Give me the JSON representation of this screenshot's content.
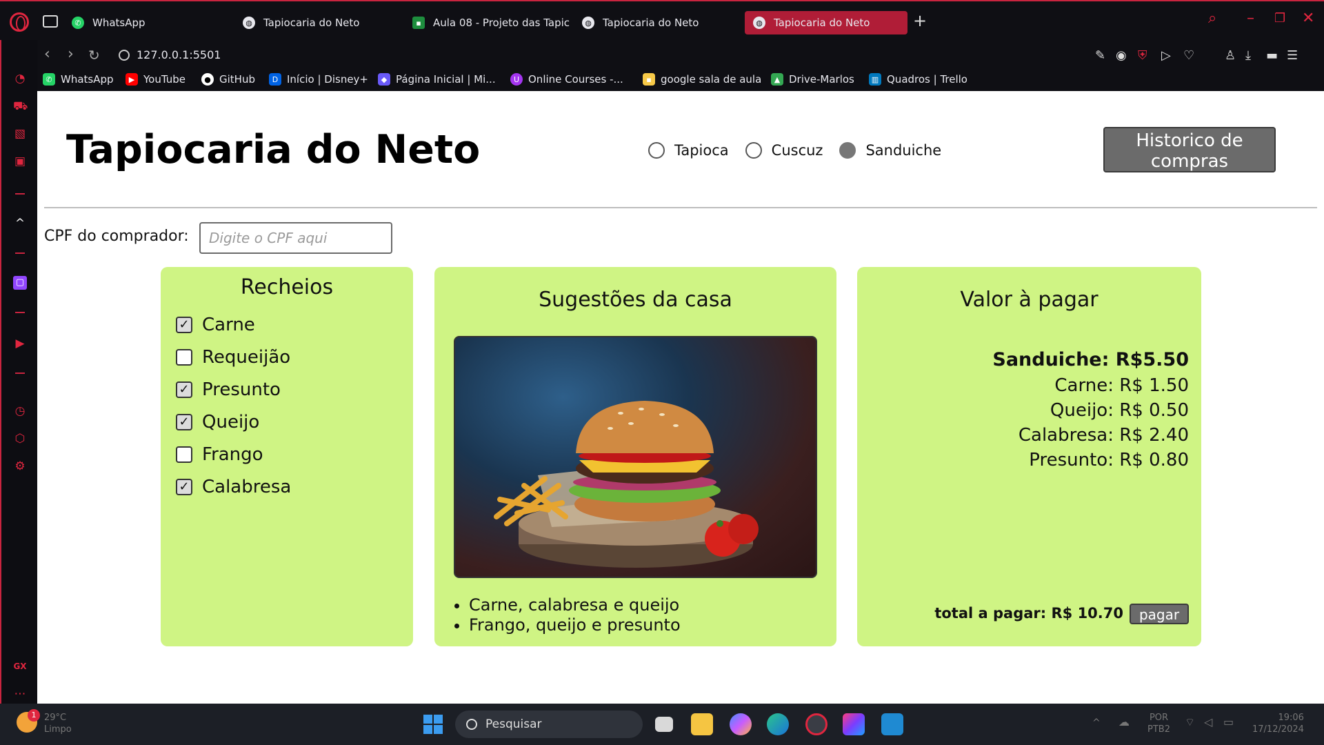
{
  "browser": {
    "tabs": [
      {
        "label": "WhatsApp",
        "icon": "whatsapp-icon",
        "active": false
      },
      {
        "label": "Tapiocaria do Neto",
        "icon": "globe-icon",
        "active": false
      },
      {
        "label": "Aula 08 - Projeto das Tapic",
        "icon": "classroom-icon",
        "active": false
      },
      {
        "label": "Tapiocaria do Neto",
        "icon": "globe-icon",
        "active": false
      },
      {
        "label": "Tapiocaria do Neto",
        "icon": "globe-icon",
        "active": true
      }
    ],
    "url": "127.0.0.1:5501",
    "bookmarks": [
      {
        "label": "WhatsApp",
        "icon": "whatsapp-icon",
        "color": "#25d366"
      },
      {
        "label": "YouTube",
        "icon": "youtube-icon",
        "color": "#ff0000"
      },
      {
        "label": "GitHub",
        "icon": "github-icon",
        "color": "#ffffff"
      },
      {
        "label": "Início | Disney+",
        "icon": "disney-icon",
        "color": "#0063e5"
      },
      {
        "label": "Página Inicial | Mi...",
        "icon": "microsoft-icon",
        "color": "#6a5af9"
      },
      {
        "label": "Online Courses -...",
        "icon": "udemy-icon",
        "color": "#a435f0"
      },
      {
        "label": "google sala de aula",
        "icon": "classroom-icon",
        "color": "#f7c948"
      },
      {
        "label": "Drive-Marlos",
        "icon": "drive-icon",
        "color": "#34a853"
      },
      {
        "label": "Quadros | Trello",
        "icon": "trello-icon",
        "color": "#0079bf"
      }
    ],
    "accent_color": "#c9243f"
  },
  "page": {
    "title": "Tapiocaria do Neto",
    "product_options": [
      {
        "label": "Tapioca",
        "selected": false
      },
      {
        "label": "Cuscuz",
        "selected": false
      },
      {
        "label": "Sanduiche",
        "selected": true
      }
    ],
    "history_button": "Historico de compras",
    "cpf_label": "CPF do comprador:",
    "cpf_placeholder": "Digite o CPF aqui",
    "cpf_value": "",
    "card_color": "#cff484"
  },
  "fillings": {
    "title": "Recheios",
    "items": [
      {
        "label": "Carne",
        "checked": true
      },
      {
        "label": "Requeijão",
        "checked": false
      },
      {
        "label": "Presunto",
        "checked": true
      },
      {
        "label": "Queijo",
        "checked": true
      },
      {
        "label": "Frango",
        "checked": false
      },
      {
        "label": "Calabresa",
        "checked": true
      }
    ]
  },
  "suggestions": {
    "title": "Sugestões da casa",
    "image_alt": "burger-with-fries-photo",
    "items": [
      "Carne, calabresa e queijo",
      "Frango, queijo e presunto"
    ]
  },
  "payment": {
    "title": "Valor à pagar",
    "main_line": "Sanduiche: R$5.50",
    "lines": [
      "Carne: R$ 1.50",
      "Queijo: R$ 0.50",
      "Calabresa: R$ 2.40",
      "Presunto: R$ 0.80"
    ],
    "total": "total a pagar: R$ 10.70",
    "pay_button": "pagar"
  },
  "taskbar": {
    "search_placeholder": "Pesquisar",
    "notification_count": "1",
    "weather_temp": "29°C",
    "weather_desc": "Limpo",
    "lang": "POR",
    "layout": "PTB2",
    "time": "19:06",
    "date": "17/12/2024"
  }
}
